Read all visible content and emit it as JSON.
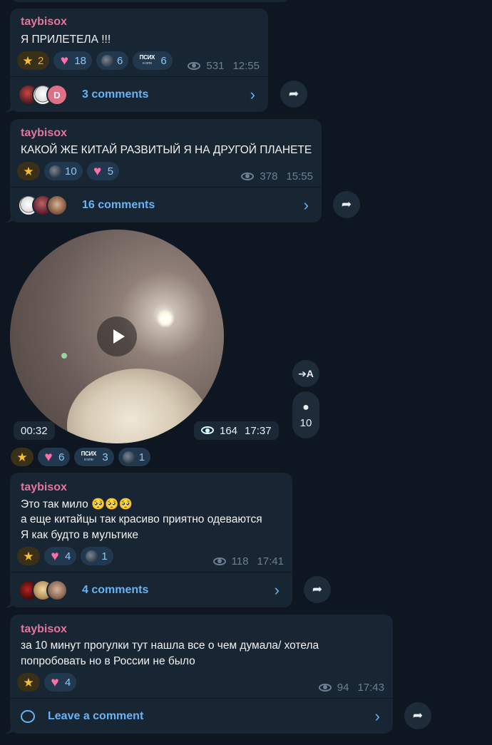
{
  "messages": [
    {
      "author": "taybisox",
      "lines": [
        "Я ПРИЛЕТЕЛА !!!"
      ],
      "reactions": [
        {
          "type": "star",
          "count": "2"
        },
        {
          "type": "heart",
          "count": "18"
        },
        {
          "type": "moon",
          "count": "6"
        },
        {
          "type": "psih",
          "count": "6"
        }
      ],
      "views": "531",
      "time": "12:55",
      "comments": "3 comments"
    },
    {
      "author": "taybisox",
      "lines": [
        "КАКОЙ ЖЕ КИТАЙ РАЗВИТЫЙ Я НА ДРУГОЙ ПЛАНЕТЕ"
      ],
      "reactions": [
        {
          "type": "star",
          "count": ""
        },
        {
          "type": "moon",
          "count": "10"
        },
        {
          "type": "heart",
          "count": "5"
        }
      ],
      "views": "378",
      "time": "15:55",
      "comments": "16 comments"
    },
    {
      "author": "taybisox",
      "lines": [
        "Это так мило 🥺🥺🥺",
        "а еще китайцы так красиво приятно одеваются",
        "Я как будто в мультике"
      ],
      "reactions": [
        {
          "type": "star",
          "count": ""
        },
        {
          "type": "heart",
          "count": "4"
        },
        {
          "type": "moon",
          "count": "1"
        }
      ],
      "views": "118",
      "time": "17:41",
      "comments": "4 comments"
    },
    {
      "author": "taybisox",
      "lines": [
        "за 10 минут прогулки тут нашла все о чем думала/ хотела",
        "попробовать но в России не было"
      ],
      "reactions": [
        {
          "type": "star",
          "count": ""
        },
        {
          "type": "heart",
          "count": "4"
        }
      ],
      "views": "94",
      "time": "17:43",
      "comments": "Leave a comment"
    }
  ],
  "video": {
    "duration": "00:32",
    "views": "164",
    "time": "17:37",
    "comment_count": "10",
    "translate_label": "A",
    "reactions": [
      {
        "type": "star",
        "count": ""
      },
      {
        "type": "heart",
        "count": "6"
      },
      {
        "type": "psih",
        "count": "3"
      },
      {
        "type": "moon",
        "count": "1"
      }
    ]
  },
  "sticker": {
    "psih_word": "ПСИХ",
    "psih_sub": "в сети"
  },
  "icons": {
    "forward": "share-arrow-icon",
    "chevron": "chevron-right-icon",
    "eye": "eye-icon",
    "play": "play-icon"
  },
  "colors": {
    "background": "#0e1621",
    "bubble": "#182533",
    "author": "#e5759f",
    "link": "#6ab3f3",
    "meta": "#6d8094"
  }
}
